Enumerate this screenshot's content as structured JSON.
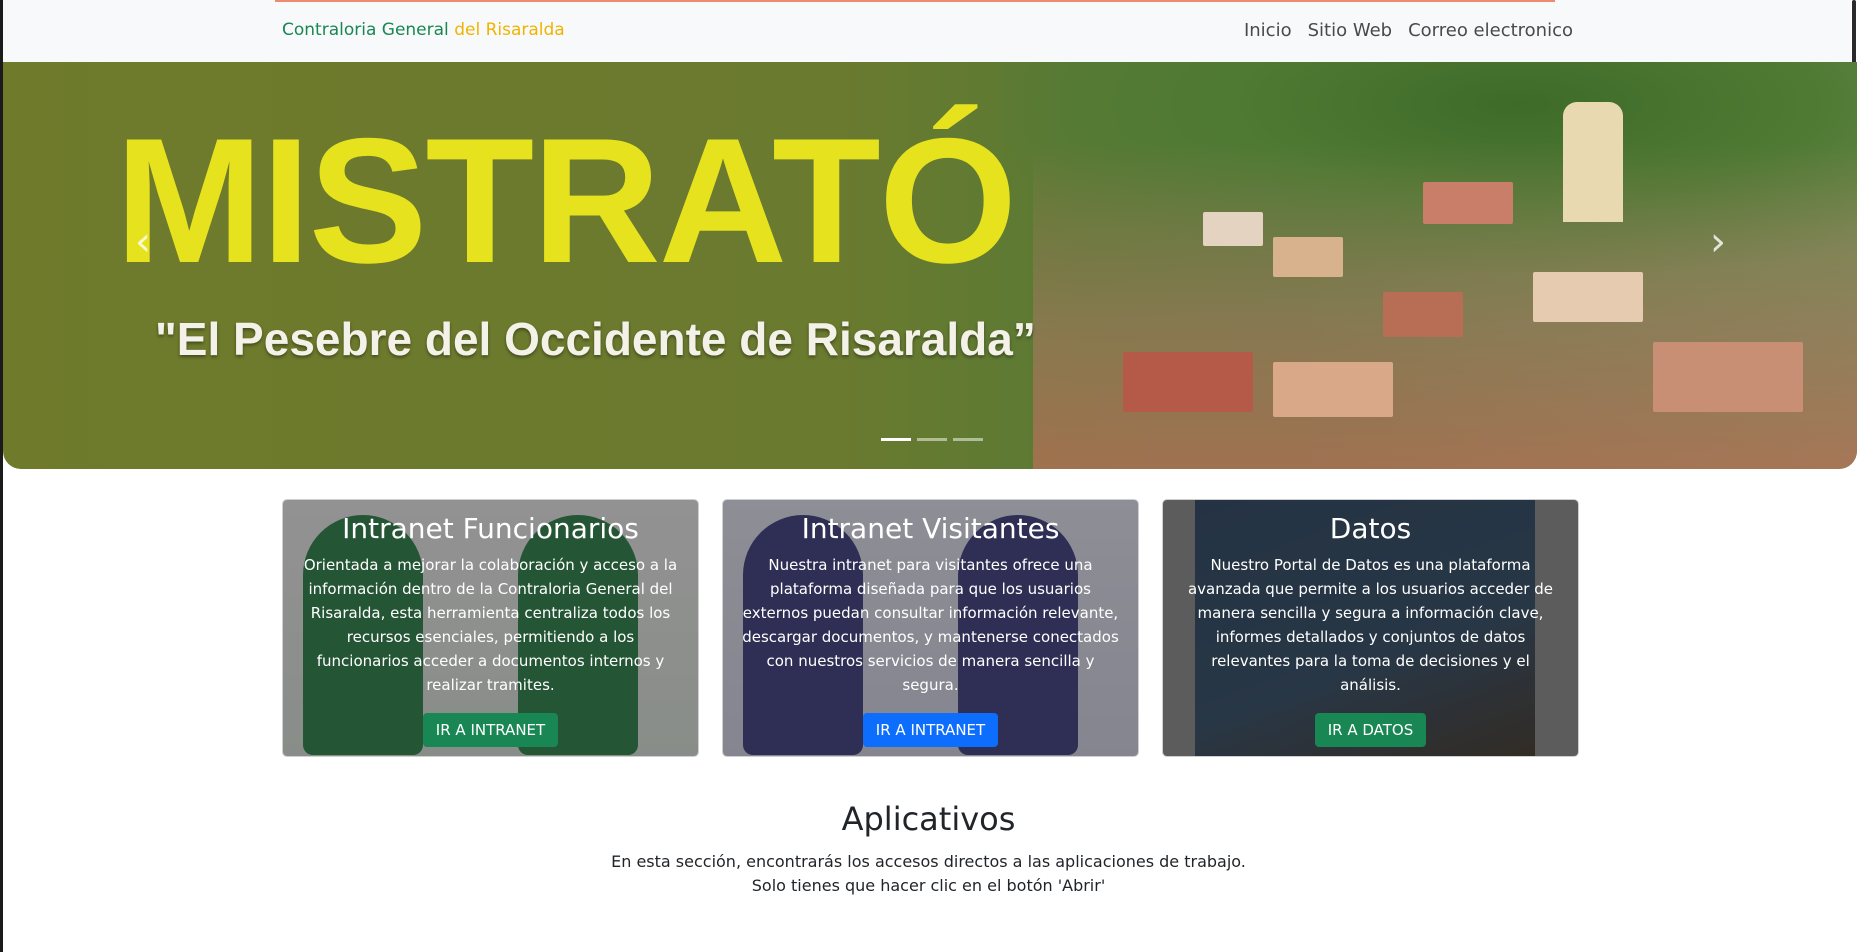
{
  "navbar": {
    "brand_part1": "Contraloria General",
    "brand_part2": "del Risaralda",
    "links": [
      "Inicio",
      "Sitio Web",
      "Correo electronico"
    ]
  },
  "hero": {
    "title": "MISTRATÓ",
    "subtitle": "\"El Pesebre del Occidente de Risaralda”",
    "prev_icon": "chevron-left-icon",
    "next_icon": "chevron-right-icon",
    "prev_glyph": "‹",
    "next_glyph": "›",
    "slides": 3,
    "active_slide": 1
  },
  "cards": [
    {
      "title": "Intranet Funcionarios",
      "text": "Orientada a mejorar la colaboración y acceso a la información dentro de la Contraloria General del Risaralda, esta herramienta centraliza todos los recursos esenciales, permitiendo a los funcionarios acceder a documentos internos y realizar tramites.",
      "button": "IR A INTRANET"
    },
    {
      "title": "Intranet Visitantes",
      "text": "Nuestra intranet para visitantes ofrece una plataforma diseñada para que los usuarios externos puedan consultar información relevante, descargar documentos, y mantenerse conectados con nuestros servicios de manera sencilla y segura.",
      "button": "IR A INTRANET"
    },
    {
      "title": "Datos",
      "text": "Nuestro Portal de Datos es una plataforma avanzada que permite a los usuarios acceder de manera sencilla y segura a información clave, informes detallados y conjuntos de datos relevantes para la toma de decisiones y el análisis.",
      "button": "IR A DATOS"
    }
  ],
  "apps": {
    "title": "Aplicativos",
    "line1": "En esta sección, encontrarás los accesos directos a las aplicaciones de trabajo.",
    "line2": "Solo tienes que hacer clic en el botón 'Abrir'"
  },
  "colors": {
    "brand_green": "#198754",
    "brand_yellow": "#f0b400",
    "btn_blue": "#0d6efd",
    "hero_title": "#e6e21e"
  }
}
